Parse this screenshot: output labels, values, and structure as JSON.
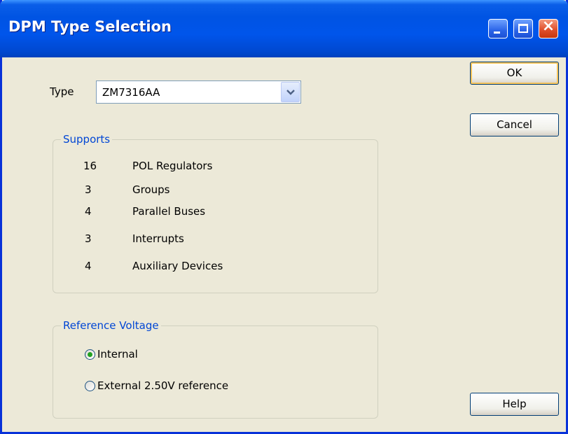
{
  "window": {
    "title": "DPM Type Selection"
  },
  "type_field": {
    "label": "Type",
    "value": "ZM7316AA"
  },
  "supports": {
    "legend": "Supports",
    "rows": [
      {
        "count": "16",
        "label": "POL Regulators"
      },
      {
        "count": "3",
        "label": "Groups"
      },
      {
        "count": "4",
        "label": "Parallel Buses"
      },
      {
        "count": "3",
        "label": "Interrupts"
      },
      {
        "count": "4",
        "label": "Auxiliary Devices"
      }
    ]
  },
  "reference_voltage": {
    "legend": "Reference Voltage",
    "options": [
      {
        "label": "Internal",
        "selected": true
      },
      {
        "label": "External 2.50V reference",
        "selected": false
      }
    ]
  },
  "buttons": {
    "ok": "OK",
    "cancel": "Cancel",
    "help": "Help"
  },
  "colors": {
    "title_bar": "#0054e3",
    "group_legend": "#0046d5",
    "radio_dot": "#21a121",
    "dialog_bg": "#ece9d8"
  }
}
